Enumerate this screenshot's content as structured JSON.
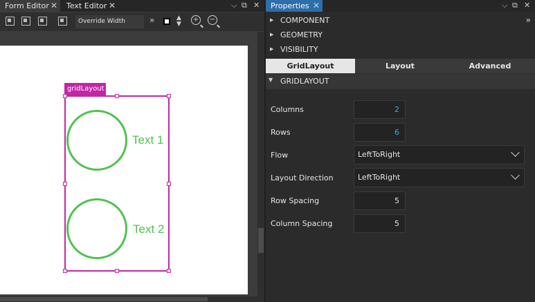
{
  "tabs_left": {
    "form_editor": "Form Editor",
    "text_editor": "Text Editor"
  },
  "tabs_right": {
    "properties": "Properties"
  },
  "toolbar": {
    "override_width": "Override Width",
    "more": "»"
  },
  "canvas": {
    "layout_tag": "gridLayout",
    "item1_text": "Text 1",
    "item2_text": "Text 2"
  },
  "properties": {
    "more": "»",
    "sections": [
      "COMPONENT",
      "GEOMETRY",
      "VISIBILITY"
    ],
    "subtabs": [
      "GridLayout",
      "Layout",
      "Advanced"
    ],
    "group_title": "GRIDLAYOUT",
    "rows": {
      "columns_label": "Columns",
      "columns_value": "2",
      "rows_label": "Rows",
      "rows_value": "6",
      "flow_label": "Flow",
      "flow_value": "LeftToRight",
      "layout_direction_label": "Layout Direction",
      "layout_direction_value": "LeftToRight",
      "row_spacing_label": "Row Spacing",
      "row_spacing_value": "5",
      "column_spacing_label": "Column Spacing",
      "column_spacing_value": "5"
    }
  },
  "colors": {
    "accent_tab": "#2e6ea9",
    "layout_magenta": "#c126a6",
    "item_green": "#4fc24d",
    "value_blue": "#3aaae0"
  }
}
